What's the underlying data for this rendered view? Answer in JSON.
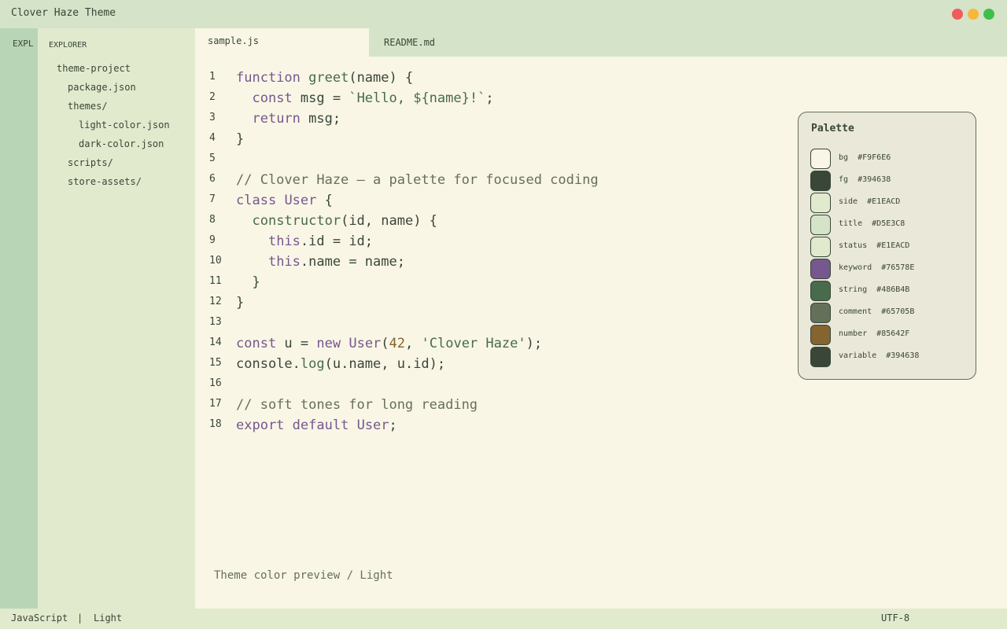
{
  "window": {
    "title": "Clover Haze Theme"
  },
  "activity_bar": {
    "label": "EXPL"
  },
  "sidebar": {
    "heading": "EXPLORER",
    "tree": [
      {
        "label": "theme-project"
      },
      {
        "label": "package.json"
      },
      {
        "label": "themes/"
      },
      {
        "label": "light-color.json"
      },
      {
        "label": "dark-color.json"
      },
      {
        "label": "scripts/"
      },
      {
        "label": "store-assets/"
      }
    ]
  },
  "tabs": [
    {
      "label": "sample.js",
      "active": true
    },
    {
      "label": "README.md",
      "active": false
    }
  ],
  "editor": {
    "lines": [
      {
        "n": "1",
        "tokens": [
          [
            "kw",
            "function"
          ],
          [
            "var",
            " "
          ],
          [
            "fn",
            "greet"
          ],
          [
            "var",
            "(name) {"
          ]
        ]
      },
      {
        "n": "2",
        "tokens": [
          [
            "var",
            "  "
          ],
          [
            "kw",
            "const"
          ],
          [
            "var",
            " msg = "
          ],
          [
            "str",
            "`Hello, ${name}!`"
          ],
          [
            "var",
            ";"
          ]
        ]
      },
      {
        "n": "3",
        "tokens": [
          [
            "var",
            "  "
          ],
          [
            "kw",
            "return"
          ],
          [
            "var",
            " msg;"
          ]
        ]
      },
      {
        "n": "4",
        "tokens": [
          [
            "var",
            "}"
          ]
        ]
      },
      {
        "n": "5",
        "tokens": []
      },
      {
        "n": "6",
        "tokens": [
          [
            "cm",
            "// Clover Haze — a palette for focused coding"
          ]
        ]
      },
      {
        "n": "7",
        "tokens": [
          [
            "kw",
            "class"
          ],
          [
            "var",
            " "
          ],
          [
            "cls",
            "User"
          ],
          [
            "var",
            " {"
          ]
        ]
      },
      {
        "n": "8",
        "tokens": [
          [
            "var",
            "  "
          ],
          [
            "fn",
            "constructor"
          ],
          [
            "var",
            "(id, name) {"
          ]
        ]
      },
      {
        "n": "9",
        "tokens": [
          [
            "var",
            "    "
          ],
          [
            "kw",
            "this"
          ],
          [
            "var",
            ".id = id;"
          ]
        ]
      },
      {
        "n": "10",
        "tokens": [
          [
            "var",
            "    "
          ],
          [
            "kw",
            "this"
          ],
          [
            "var",
            ".name = name;"
          ]
        ]
      },
      {
        "n": "11",
        "tokens": [
          [
            "var",
            "  }"
          ]
        ]
      },
      {
        "n": "12",
        "tokens": [
          [
            "var",
            "}"
          ]
        ]
      },
      {
        "n": "13",
        "tokens": []
      },
      {
        "n": "14",
        "tokens": [
          [
            "kw",
            "const"
          ],
          [
            "var",
            " u = "
          ],
          [
            "kw",
            "new"
          ],
          [
            "var",
            " "
          ],
          [
            "cls",
            "User"
          ],
          [
            "var",
            "("
          ],
          [
            "num",
            "42"
          ],
          [
            "var",
            ", "
          ],
          [
            "str",
            "'Clover Haze'"
          ],
          [
            "var",
            ");"
          ]
        ]
      },
      {
        "n": "15",
        "tokens": [
          [
            "var",
            "console."
          ],
          [
            "fn",
            "log"
          ],
          [
            "var",
            "(u.name, u.id);"
          ]
        ]
      },
      {
        "n": "16",
        "tokens": []
      },
      {
        "n": "17",
        "tokens": [
          [
            "cm",
            "// soft tones for long reading"
          ]
        ]
      },
      {
        "n": "18",
        "tokens": [
          [
            "kw",
            "export"
          ],
          [
            "var",
            " "
          ],
          [
            "kw",
            "default"
          ],
          [
            "var",
            " "
          ],
          [
            "cls",
            "User"
          ],
          [
            "var",
            ";"
          ]
        ]
      }
    ],
    "caption": "Theme color preview / Light"
  },
  "palette": {
    "title": "Palette",
    "entries": [
      {
        "name": "bg",
        "hex": "#F9F6E6"
      },
      {
        "name": "fg",
        "hex": "#394638"
      },
      {
        "name": "side",
        "hex": "#E1EACD"
      },
      {
        "name": "title",
        "hex": "#D5E3C8"
      },
      {
        "name": "status",
        "hex": "#E1EACD"
      },
      {
        "name": "keyword",
        "hex": "#76578E"
      },
      {
        "name": "string",
        "hex": "#486B4B"
      },
      {
        "name": "comment",
        "hex": "#65705B"
      },
      {
        "name": "number",
        "hex": "#85642F"
      },
      {
        "name": "variable",
        "hex": "#394638"
      }
    ]
  },
  "status_bar": {
    "language": "JavaScript",
    "separator": "|",
    "theme": "Light",
    "encoding": "UTF-8"
  }
}
